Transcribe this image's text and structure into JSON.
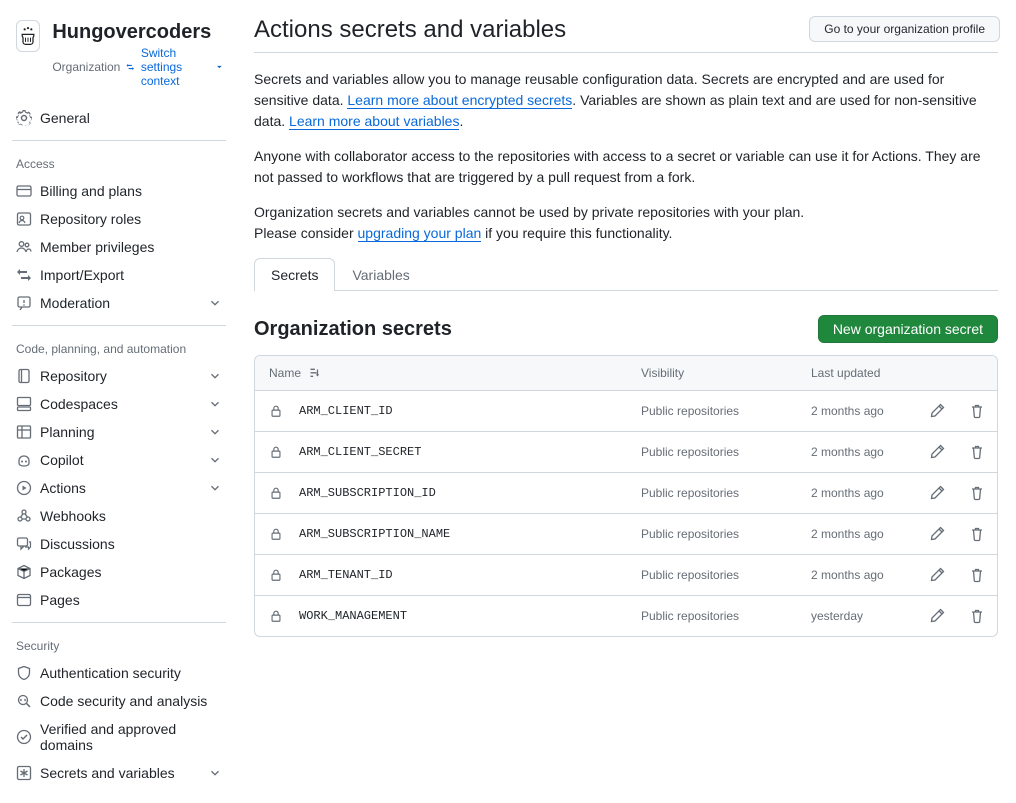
{
  "org": {
    "name": "Hungovercoders",
    "type_label": "Organization",
    "switch_label": "Switch settings context"
  },
  "top_button": "Go to your organization profile",
  "nav": {
    "general": "General",
    "groups": [
      {
        "heading": "Access",
        "items": [
          {
            "label": "Billing and plans",
            "icon": "card",
            "chev": false
          },
          {
            "label": "Repository roles",
            "icon": "roles",
            "chev": false
          },
          {
            "label": "Member privileges",
            "icon": "people",
            "chev": false
          },
          {
            "label": "Import/Export",
            "icon": "swap",
            "chev": false
          },
          {
            "label": "Moderation",
            "icon": "report",
            "chev": true
          }
        ]
      },
      {
        "heading": "Code, planning, and automation",
        "items": [
          {
            "label": "Repository",
            "icon": "repo",
            "chev": true
          },
          {
            "label": "Codespaces",
            "icon": "codespaces",
            "chev": true
          },
          {
            "label": "Planning",
            "icon": "table",
            "chev": true
          },
          {
            "label": "Copilot",
            "icon": "copilot",
            "chev": true
          },
          {
            "label": "Actions",
            "icon": "play",
            "chev": true
          },
          {
            "label": "Webhooks",
            "icon": "webhook",
            "chev": false
          },
          {
            "label": "Discussions",
            "icon": "discussion",
            "chev": false
          },
          {
            "label": "Packages",
            "icon": "package",
            "chev": false
          },
          {
            "label": "Pages",
            "icon": "browser",
            "chev": false
          }
        ]
      },
      {
        "heading": "Security",
        "items": [
          {
            "label": "Authentication security",
            "icon": "shield",
            "chev": false
          },
          {
            "label": "Code security and analysis",
            "icon": "codescan",
            "chev": false
          },
          {
            "label": "Verified and approved domains",
            "icon": "verified",
            "chev": false
          },
          {
            "label": "Secrets and variables",
            "icon": "asterisk",
            "chev": true
          }
        ]
      }
    ]
  },
  "page": {
    "title": "Actions secrets and variables",
    "intro1_a": "Secrets and variables allow you to manage reusable configuration data. Secrets are encrypted and are used for sensitive data. ",
    "intro1_link1": "Learn more about encrypted secrets",
    "intro1_b": ". Variables are shown as plain text and are used for non-sensitive data. ",
    "intro1_link2": "Learn more about variables",
    "intro1_c": ".",
    "intro2": "Anyone with collaborator access to the repositories with access to a secret or variable can use it for Actions. They are not passed to workflows that are triggered by a pull request from a fork.",
    "intro3_a": "Organization secrets and variables cannot be used by private repositories with your plan.",
    "intro3_b": "Please consider ",
    "intro3_link": "upgrading your plan",
    "intro3_c": " if you require this functionality."
  },
  "tabs": {
    "secrets": "Secrets",
    "variables": "Variables"
  },
  "section": {
    "title": "Organization secrets",
    "new_button": "New organization secret",
    "col_name": "Name",
    "col_visibility": "Visibility",
    "col_updated": "Last updated"
  },
  "secrets": [
    {
      "name": "ARM_CLIENT_ID",
      "visibility": "Public repositories",
      "updated": "2 months ago"
    },
    {
      "name": "ARM_CLIENT_SECRET",
      "visibility": "Public repositories",
      "updated": "2 months ago"
    },
    {
      "name": "ARM_SUBSCRIPTION_ID",
      "visibility": "Public repositories",
      "updated": "2 months ago"
    },
    {
      "name": "ARM_SUBSCRIPTION_NAME",
      "visibility": "Public repositories",
      "updated": "2 months ago"
    },
    {
      "name": "ARM_TENANT_ID",
      "visibility": "Public repositories",
      "updated": "2 months ago"
    },
    {
      "name": "WORK_MANAGEMENT",
      "visibility": "Public repositories",
      "updated": "yesterday"
    }
  ]
}
